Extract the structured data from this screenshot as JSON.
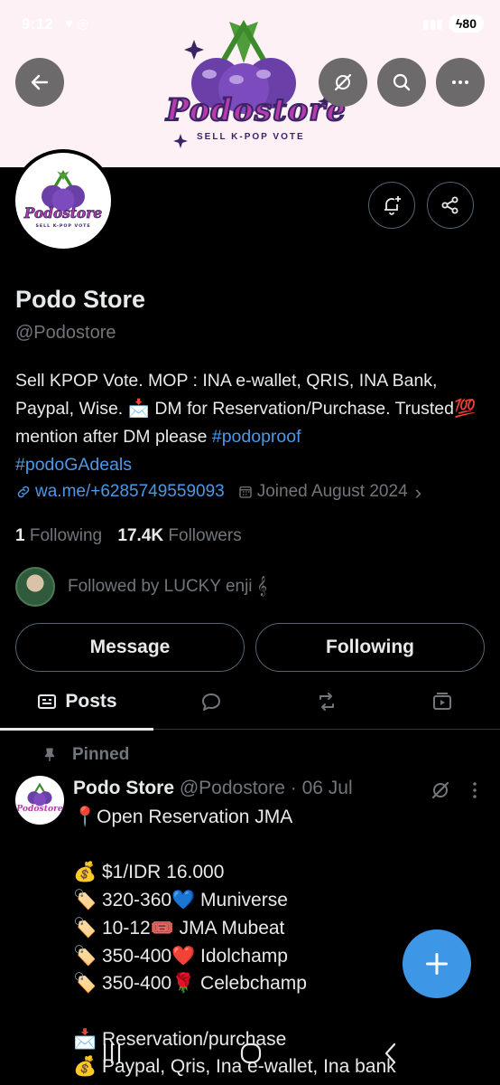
{
  "status_bar": {
    "time": "9:12",
    "battery": "80"
  },
  "banner": {
    "brand": "Podostore",
    "tagline": "SELL K-POP VOTE"
  },
  "profile": {
    "name": "Podo Store",
    "handle": "@Podostore",
    "bio_part1": "Sell KPOP Vote. MOP : INA e-wallet, QRIS, INA Bank, Paypal, Wise. 📩 DM for Reservation/Purchase. Trusted💯 mention after DM please ",
    "bio_tag1": "#podoproof",
    "bio_tag2": "#podoGAdeals",
    "link": "wa.me/+6285749559093",
    "joined": "Joined August 2024",
    "following_count": "1",
    "following_label": "Following",
    "followers_count": "17.4K",
    "followers_label": "Followers",
    "followed_by": "Followed by LUCKY enji 𝄞"
  },
  "actions": {
    "message": "Message",
    "following": "Following"
  },
  "tabs": {
    "posts": "Posts"
  },
  "post": {
    "pinned_label": "Pinned",
    "author": "Podo Store",
    "handle": "@Podostore",
    "separator": "·",
    "date": "06 Jul",
    "body": "📍Open Reservation JMA\n\n💰 $1/IDR 16.000\n🏷️ 320-360💙 Muniverse\n🏷️ 10-12🎟️ JMA Mubeat\n🏷️ 350-400❤️ Idolchamp\n🏷️ 350-400🌹 Celebchamp\n\n📩 Reservation/purchase\n💰 Paypal, Qris, Ina e-wallet, Ina bank"
  },
  "colors": {
    "accent": "#4a99e9",
    "fab": "#3d97e6",
    "banner_bg": "#fdf1f5",
    "grape": "#6b3fa8"
  }
}
